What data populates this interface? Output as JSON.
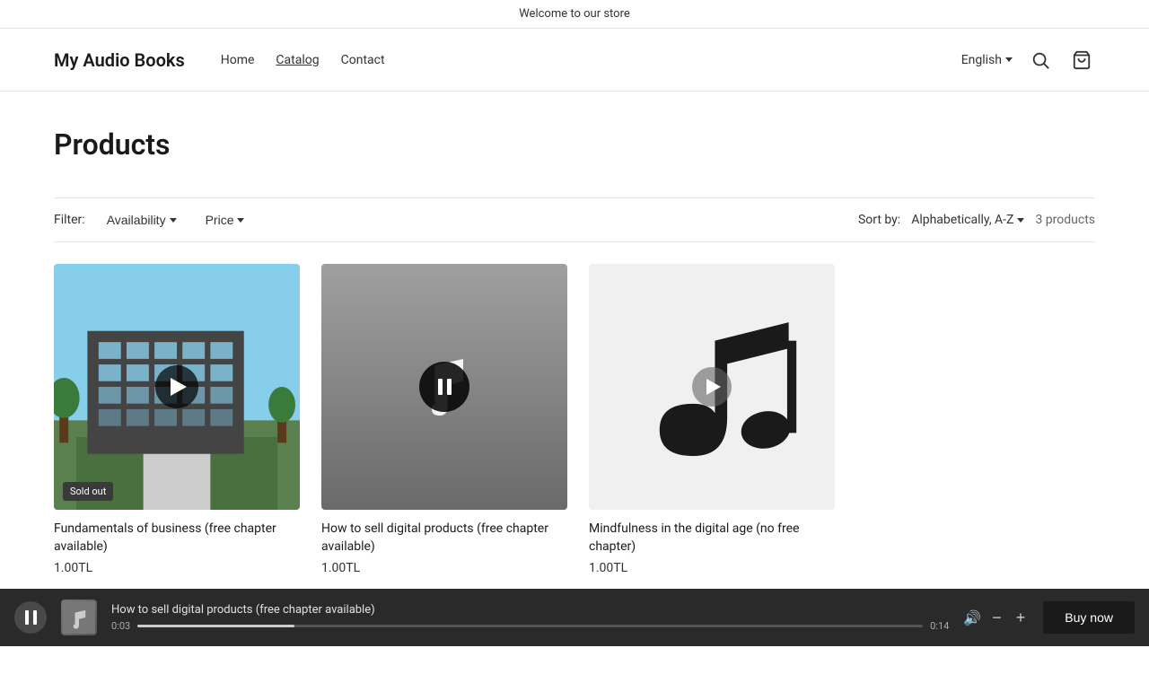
{
  "topBanner": {
    "text": "Welcome to our store"
  },
  "header": {
    "logo": "My Audio Books",
    "nav": [
      {
        "label": "Home",
        "active": false
      },
      {
        "label": "Catalog",
        "active": true
      },
      {
        "label": "Contact",
        "active": false
      }
    ],
    "language": "English",
    "searchLabel": "Search",
    "cartLabel": "Cart"
  },
  "page": {
    "title": "Products"
  },
  "filters": {
    "label": "Filter:",
    "availability": "Availability",
    "price": "Price",
    "sortLabel": "Sort by:",
    "sortValue": "Alphabetically, A-Z",
    "productsCount": "3 products"
  },
  "products": [
    {
      "id": 1,
      "name": "Fundamentals of business (free chapter available)",
      "price": "1.00TL",
      "soldOut": true,
      "imageType": "building",
      "playState": "play"
    },
    {
      "id": 2,
      "name": "How to sell digital products (free chapter available)",
      "price": "1.00TL",
      "soldOut": false,
      "imageType": "music-gray",
      "playState": "pause"
    },
    {
      "id": 3,
      "name": "Mindfulness in the digital age (no free chapter)",
      "price": "1.00TL",
      "soldOut": false,
      "imageType": "music-white",
      "playState": "play"
    }
  ],
  "audioPlayer": {
    "trackName": "How to sell digital products (free chapter available)",
    "currentTime": "0:03",
    "totalTime": "0:14",
    "progressPercent": 20,
    "buyNowLabel": "Buy now"
  }
}
